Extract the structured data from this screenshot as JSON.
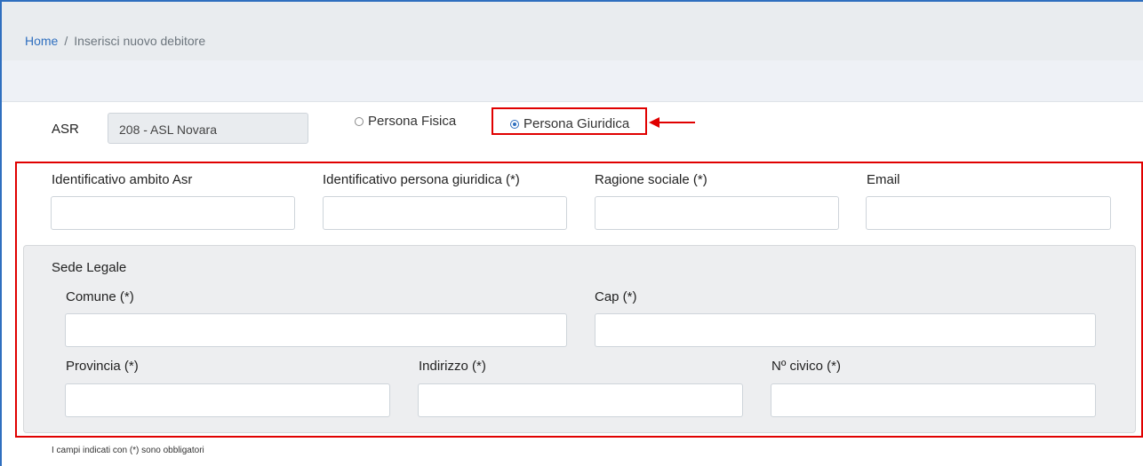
{
  "breadcrumb": {
    "home": "Home",
    "separator": "/",
    "current": "Inserisci nuovo debitore"
  },
  "asr": {
    "label": "ASR",
    "value": "208 - ASL Novara"
  },
  "radio": {
    "fisica": {
      "label": "Persona Fisica",
      "checked": false
    },
    "giuridica": {
      "label": "Persona Giuridica",
      "checked": true
    }
  },
  "fields": {
    "identificativo_ambito": {
      "label": "Identificativo ambito Asr",
      "value": ""
    },
    "identificativo_giuridica": {
      "label": "Identificativo persona giuridica (*)",
      "value": ""
    },
    "ragione_sociale": {
      "label": "Ragione sociale (*)",
      "value": ""
    },
    "email": {
      "label": "Email",
      "value": ""
    }
  },
  "sede_legale": {
    "title": "Sede Legale",
    "comune": {
      "label": "Comune (*)",
      "value": ""
    },
    "cap": {
      "label": "Cap (*)",
      "value": ""
    },
    "provincia": {
      "label": "Provincia (*)",
      "value": ""
    },
    "indirizzo": {
      "label": "Indirizzo (*)",
      "value": ""
    },
    "civico": {
      "label": "Nº civico (*)",
      "value": ""
    }
  },
  "footnote": "I campi indicati con (*) sono obbligatori",
  "colors": {
    "link": "#2f6fbf",
    "highlight": "#e00000"
  }
}
